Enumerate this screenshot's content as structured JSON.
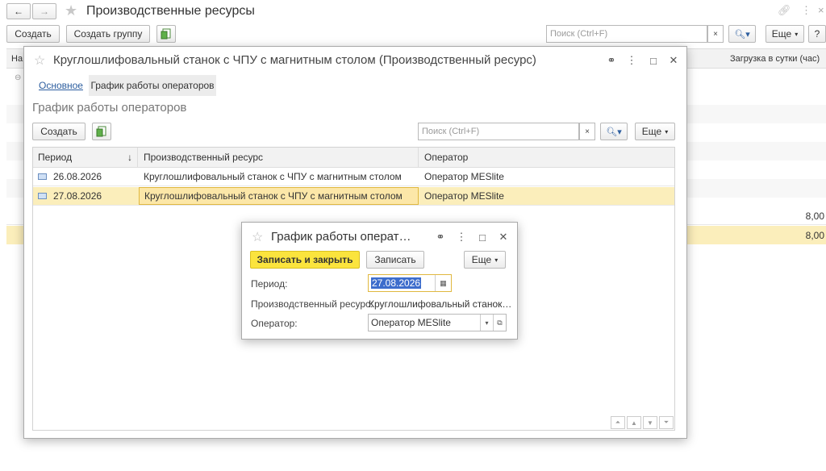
{
  "main": {
    "title": "Производственные ресурсы",
    "toolbar": {
      "create": "Создать",
      "create_group": "Создать группу",
      "search_placeholder": "Поиск (Ctrl+F)",
      "clear": "×",
      "more": "Еще",
      "help": "?"
    },
    "columns": {
      "first": "На",
      "load": "Загрузка в сутки (час)"
    },
    "rows": [
      {
        "load": "8,00"
      },
      {
        "load": "8,00"
      }
    ]
  },
  "resource_window": {
    "title": "Круглошлифовальный станок с ЧПУ с магнитным столом (Производственный ресурс)",
    "tabs": [
      "Основное",
      "График работы операторов"
    ],
    "section_title": "График работы операторов",
    "create": "Создать",
    "search_placeholder": "Поиск (Ctrl+F)",
    "clear": "×",
    "more": "Еще",
    "columns": {
      "period": "Период",
      "sort": "↓",
      "resource": "Производственный ресурс",
      "operator": "Оператор"
    },
    "rows": [
      {
        "date": "26.08.2026",
        "resource": "Круглошлифовальный станок с ЧПУ с магнитным столом",
        "operator": "Оператор MESlite"
      },
      {
        "date": "27.08.2026",
        "resource": "Круглошлифовальный станок с ЧПУ с магнитным столом",
        "operator": "Оператор MESlite"
      }
    ]
  },
  "record_window": {
    "title": "График работы операт…",
    "save_close": "Записать и закрыть",
    "save": "Записать",
    "more": "Еще",
    "period_label": "Период:",
    "period_value": "27.08.2026",
    "resource_label": "Производственный ресурс:",
    "resource_value": "Круглошлифовальный станок…",
    "operator_label": "Оператор:",
    "operator_value": "Оператор MESlite"
  },
  "colors": {
    "accent_yellow": "#fbe43d",
    "selected_row": "#fbeebb",
    "link_blue": "#2d5e9f"
  }
}
